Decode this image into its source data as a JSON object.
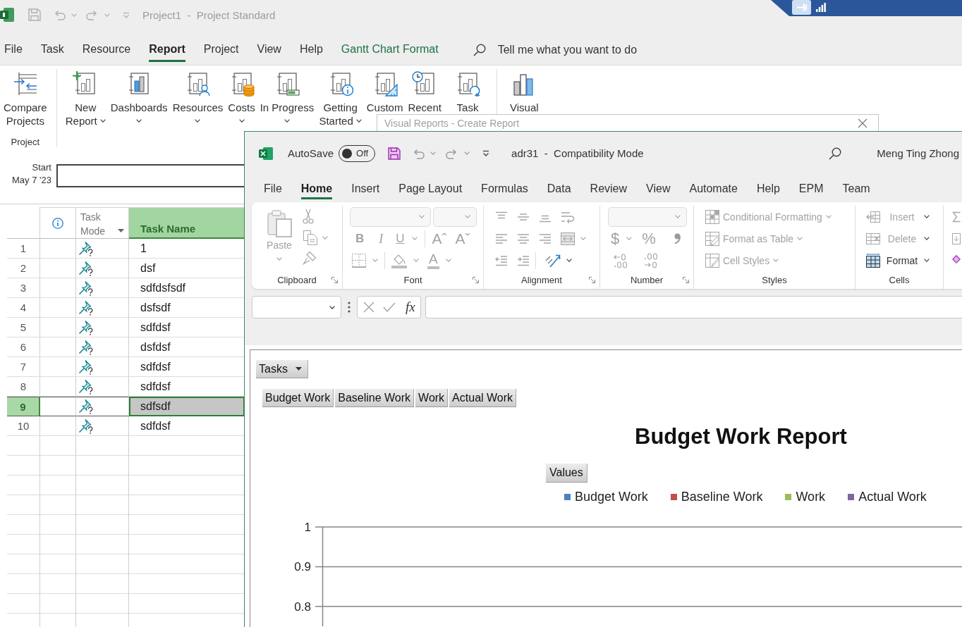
{
  "project": {
    "app_title": "Project1  -  Project Standard",
    "menu_tabs": [
      {
        "label": "File",
        "selected": false,
        "kind": "standard"
      },
      {
        "label": "Task",
        "selected": false,
        "kind": "standard"
      },
      {
        "label": "Resource",
        "selected": false,
        "kind": "standard"
      },
      {
        "label": "Report",
        "selected": true,
        "kind": "standard"
      },
      {
        "label": "Project",
        "selected": false,
        "kind": "standard"
      },
      {
        "label": "View",
        "selected": false,
        "kind": "standard"
      },
      {
        "label": "Help",
        "selected": false,
        "kind": "standard"
      },
      {
        "label": "Gantt Chart Format",
        "selected": false,
        "kind": "contextual"
      }
    ],
    "tell_me": {
      "placeholder": "Tell me what you want to do"
    },
    "ribbon_groups": [
      {
        "label": "Project",
        "buttons": [
          {
            "lines": [
              "Compare",
              "Projects"
            ],
            "dropdown": false
          }
        ]
      },
      {
        "buttons": [
          {
            "lines": [
              "New",
              "Report"
            ],
            "dropdown": true
          },
          {
            "lines": [
              "Dashboards"
            ],
            "dropdown": true
          },
          {
            "lines": [
              "Resources"
            ],
            "dropdown": true
          },
          {
            "lines": [
              "Costs"
            ],
            "dropdown": true
          },
          {
            "lines": [
              "In Progress"
            ],
            "dropdown": true
          },
          {
            "lines": [
              "Getting",
              "Started"
            ],
            "dropdown": true
          },
          {
            "lines": [
              "Custom"
            ],
            "dropdown": false
          },
          {
            "lines": [
              "Recent"
            ],
            "dropdown": false
          },
          {
            "lines": [
              "Task"
            ],
            "dropdown": false
          }
        ]
      },
      {
        "buttons": [
          {
            "lines": [
              "Visual"
            ],
            "dropdown": false
          }
        ]
      }
    ],
    "timeline": {
      "start_label": "Start",
      "start_date": "May 7 '23"
    },
    "grid": {
      "columns": [
        {
          "label": "Task Mode",
          "selected": false,
          "filter": true
        },
        {
          "label": "Task Name",
          "selected": true,
          "filter": false
        }
      ],
      "rows": [
        {
          "number": "1",
          "name": "1",
          "selected": false
        },
        {
          "number": "2",
          "name": "dsf",
          "selected": false
        },
        {
          "number": "3",
          "name": "sdfdsfsdf",
          "selected": false
        },
        {
          "number": "4",
          "name": "dsfsdf",
          "selected": false
        },
        {
          "number": "5",
          "name": "sdfdsf",
          "selected": false
        },
        {
          "number": "6",
          "name": "dsfdsf",
          "selected": false
        },
        {
          "number": "7",
          "name": "sdfdsf",
          "selected": false
        },
        {
          "number": "8",
          "name": "sdfdsf",
          "selected": false
        },
        {
          "number": "9",
          "name": "sdfsdf",
          "selected": true
        },
        {
          "number": "10",
          "name": "sdfdsf",
          "selected": false
        }
      ]
    }
  },
  "dialog": {
    "title": "Visual Reports - Create Report"
  },
  "excel": {
    "autosave": {
      "label": "AutoSave",
      "on": false,
      "state": "Off"
    },
    "title": "adr31  -  Compatibility Mode",
    "user": "Meng Ting Zhong",
    "tabs": [
      {
        "label": "File",
        "selected": false
      },
      {
        "label": "Home",
        "selected": true
      },
      {
        "label": "Insert",
        "selected": false
      },
      {
        "label": "Page Layout",
        "selected": false
      },
      {
        "label": "Formulas",
        "selected": false
      },
      {
        "label": "Data",
        "selected": false
      },
      {
        "label": "Review",
        "selected": false
      },
      {
        "label": "View",
        "selected": false
      },
      {
        "label": "Automate",
        "selected": false
      },
      {
        "label": "Help",
        "selected": false
      },
      {
        "label": "EPM",
        "selected": false
      },
      {
        "label": "Team",
        "selected": false
      }
    ],
    "ribbon_groups": [
      {
        "kind": "clipboard",
        "label": "Clipboard",
        "launcher": true,
        "paste": {
          "label": "Paste",
          "disabled": true
        }
      },
      {
        "kind": "font",
        "label": "Font",
        "launcher": true,
        "style_buttons": [
          "B",
          "I",
          "U"
        ],
        "size_buttons": [
          "Aˆ",
          "Aˇ"
        ],
        "font_color": "A"
      },
      {
        "kind": "alignment",
        "label": "Alignment",
        "launcher": true
      },
      {
        "kind": "number",
        "label": "Number",
        "launcher": true,
        "symbols": [
          "$",
          "%"
        ]
      },
      {
        "kind": "styles",
        "label": "Styles",
        "launcher": false,
        "items": [
          {
            "label": "Conditional Formatting",
            "disabled": true
          },
          {
            "label": "Format as Table",
            "disabled": true
          },
          {
            "label": "Cell Styles",
            "disabled": true
          }
        ]
      },
      {
        "kind": "cells",
        "label": "Cells",
        "launcher": false,
        "items": [
          {
            "label": "Insert",
            "disabled": true
          },
          {
            "label": "Delete",
            "disabled": true
          },
          {
            "label": "Format",
            "disabled": false
          }
        ]
      }
    ],
    "formula_bar": {
      "function_label": "fx"
    },
    "pivot_chart": {
      "filter_button": "Tasks",
      "field_buttons": [
        "Budget Work",
        "Baseline Work",
        "Work",
        "Actual Work"
      ],
      "values_button": "Values",
      "chart_data": {
        "type": "bar",
        "title": "Budget Work Report",
        "legend": "top",
        "grid": true,
        "ylim": [
          0.75,
          1
        ],
        "yticks": [
          1,
          0.9,
          0.8
        ],
        "series": [
          {
            "name": "Budget Work",
            "color": "#4f81bd"
          },
          {
            "name": "Baseline Work",
            "color": "#c0504d"
          },
          {
            "name": "Work",
            "color": "#9bbb59"
          },
          {
            "name": "Actual Work",
            "color": "#8064a2"
          }
        ]
      }
    }
  }
}
